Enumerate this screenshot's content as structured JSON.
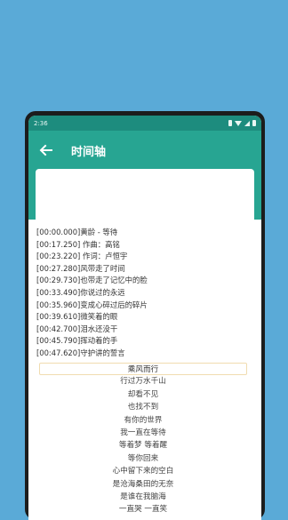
{
  "status": {
    "time": "2:36"
  },
  "appbar": {
    "title": "时间轴"
  },
  "timeline": [
    "[00:00.000]黄龄 - 等待",
    "[00:17.250] 作曲：高铭",
    "[00:23.220] 作词：卢恒宇",
    "[00:27.280]风带走了时间",
    "[00:29.730]也带走了记忆中的脸",
    "[00:33.490]你说过的永远",
    "[00:35.960]变成心碎过后的碎片",
    "[00:39.610]微笑着的眼",
    "[00:42.700]泪水还没干",
    "[00:45.790]挥动着的手",
    "[00:47.620]守护讲的誓言"
  ],
  "lyrics": [
    "乘风而行",
    "行过万水千山",
    "却看不见",
    "也找不到",
    "有你的世界",
    "我一直在等待",
    "等着梦 等着醒",
    "等你回来",
    "心中留下来的空白",
    "是沧海桑田的无奈",
    "是谁在我脑海",
    "一直哭 一直笑"
  ]
}
